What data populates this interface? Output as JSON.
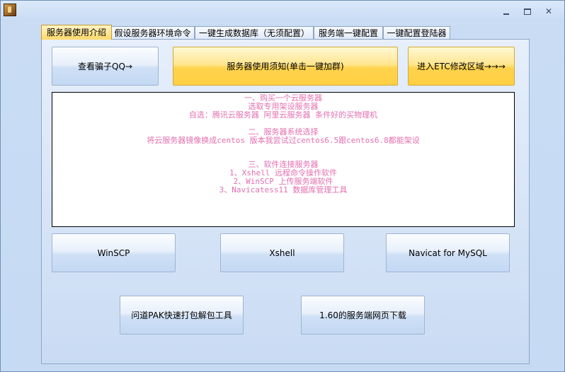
{
  "window": {
    "title": ""
  },
  "tabs": [
    {
      "label": "服务器使用介绍",
      "active": true
    },
    {
      "label": "假设服务器环境命令",
      "active": false
    },
    {
      "label": "一键生成数据库（无须配置）",
      "active": false
    },
    {
      "label": "服务端一键配置",
      "active": false
    },
    {
      "label": "一键配置登陆器",
      "active": false
    }
  ],
  "top_buttons": {
    "scammer_qq": "查看骗子QQ→",
    "server_notice": "服务器使用须知(单击一键加群)",
    "etc_edit": "进入ETC修改区域→→→"
  },
  "notice": {
    "text_color": "#e36fb0",
    "section1": {
      "title": "一、购买一个云服务器",
      "line1": "选取专用架设服务器",
      "line2": "自选：腾讯云服务器 阿里云服务器 条件好的买物理机"
    },
    "section2": {
      "title": "二、服务器系统选择",
      "line1": "将云服务器镜像换成centos 版本我尝试过centos6.5跟centos6.8都能架设"
    },
    "section3": {
      "title": "三、软件连接服务器",
      "line1": "1、Xshell 远程命令操作软件",
      "line2": "2、WinSCP 上传服务端软件",
      "line3": "3、Navicatess11 数据库管理工具"
    }
  },
  "tool_buttons": {
    "winscp": "WinSCP",
    "xshell": "Xshell",
    "navicat": "Navicat for MySQL"
  },
  "bottom_buttons": {
    "pak_tool": "问道PAK快速打包解包工具",
    "download": "1.60的服务端网页下载"
  },
  "colors": {
    "accent_gold": "#ffd34e",
    "panel_blue": "#c9dbf3"
  }
}
